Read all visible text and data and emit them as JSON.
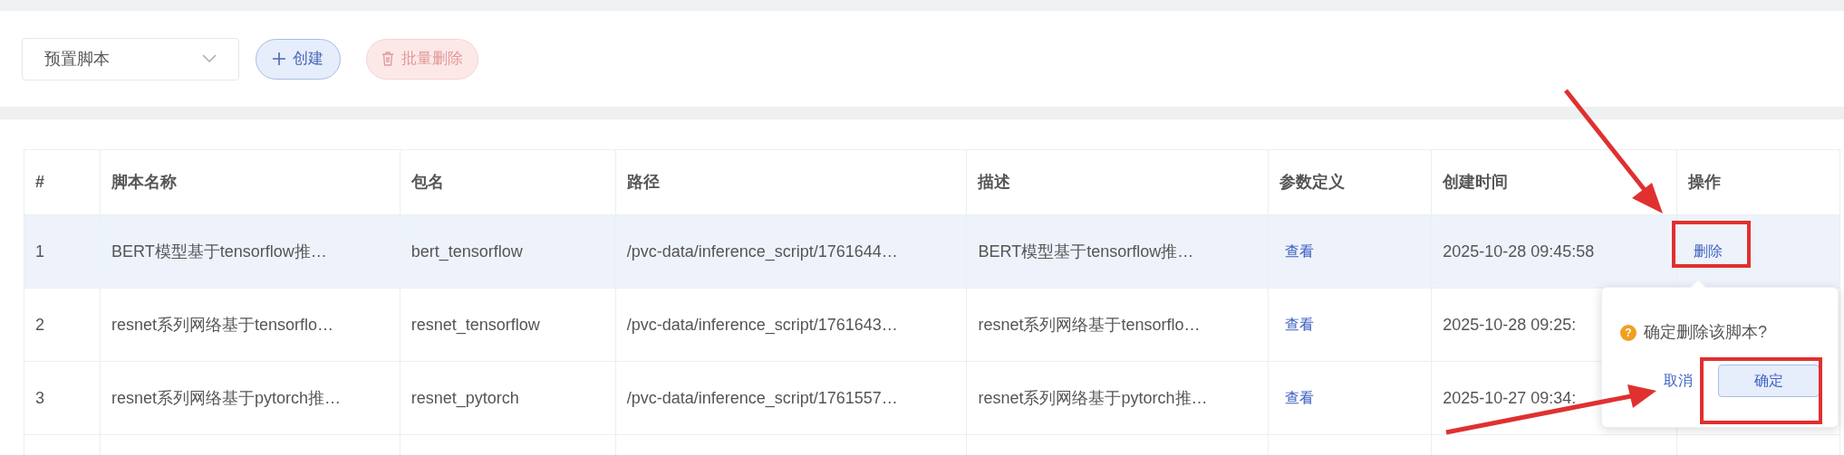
{
  "toolbar": {
    "select": {
      "value": "预置脚本"
    },
    "create_button": {
      "label": "创建"
    },
    "batch_delete_button": {
      "label": "批量删除",
      "disabled": true
    }
  },
  "table": {
    "columns": [
      "#",
      "脚本名称",
      "包名",
      "路径",
      "描述",
      "参数定义",
      "创建时间",
      "操作"
    ],
    "rows": [
      {
        "index": "1",
        "name": "BERT模型基于tensorflow推…",
        "package": "bert_tensorflow",
        "path": "/pvc-data/inference_script/1761644…",
        "description": "BERT模型基于tensorflow推…",
        "params_link": "查看",
        "created": "2025-10-28 09:45:58",
        "action": "删除",
        "highlighted": true
      },
      {
        "index": "2",
        "name": "resnet系列网络基于tensorflo…",
        "package": "resnet_tensorflow",
        "path": "/pvc-data/inference_script/1761643…",
        "description": "resnet系列网络基于tensorflo…",
        "params_link": "查看",
        "created": "2025-10-28 09:25:",
        "highlighted": false
      },
      {
        "index": "3",
        "name": "resnet系列网络基于pytorch推…",
        "package": "resnet_pytorch",
        "path": "/pvc-data/inference_script/1761557…",
        "description": "resnet系列网络基于pytorch推…",
        "params_link": "查看",
        "created": "2025-10-27 09:34:",
        "highlighted": false
      }
    ]
  },
  "popconfirm": {
    "icon": "?",
    "message": "确定删除该脚本?",
    "cancel": "取消",
    "confirm": "确定"
  }
}
